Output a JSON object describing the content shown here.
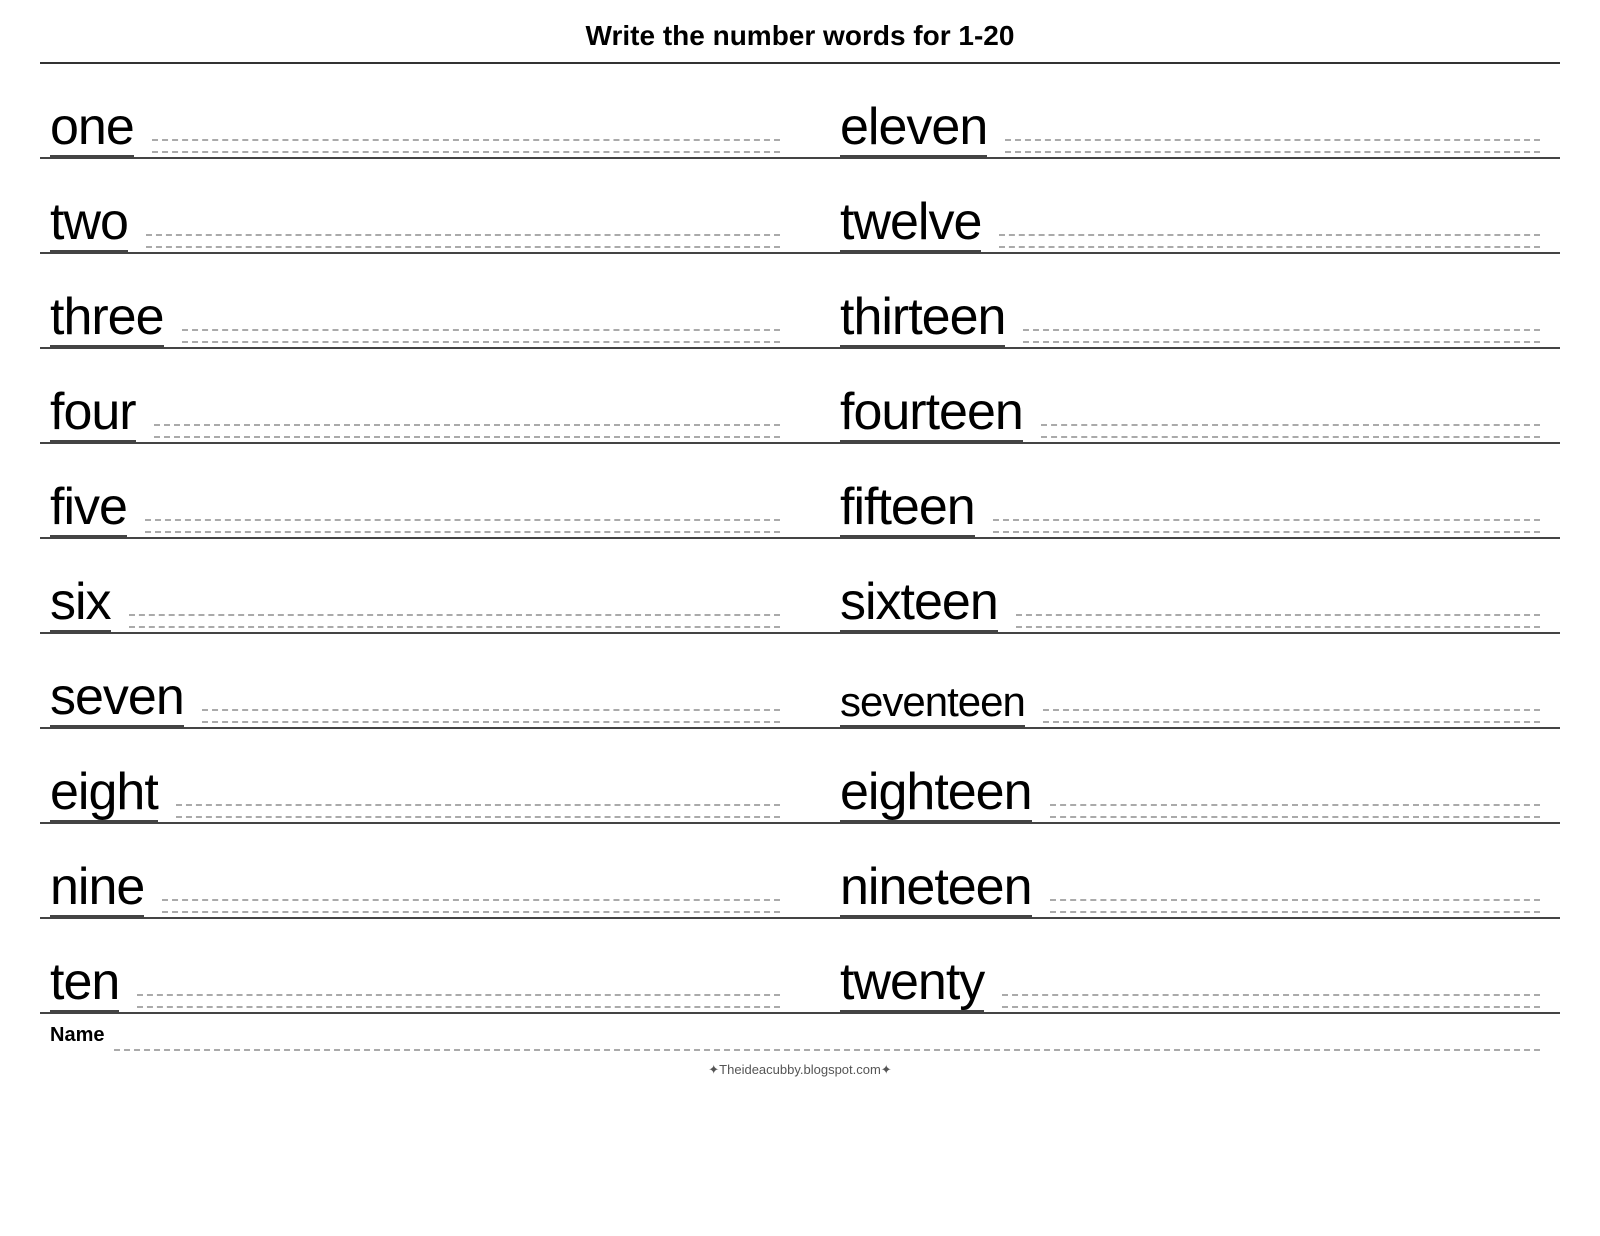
{
  "title": "Write the number words for  1-20",
  "left_column": [
    {
      "word": "one"
    },
    {
      "word": "two"
    },
    {
      "word": "three"
    },
    {
      "word": "four"
    },
    {
      "word": "five"
    },
    {
      "word": "six"
    },
    {
      "word": "seven"
    },
    {
      "word": "eight"
    },
    {
      "word": "nine"
    },
    {
      "word": "ten"
    }
  ],
  "right_column": [
    {
      "word": "eleven"
    },
    {
      "word": "twelve"
    },
    {
      "word": "thirteen"
    },
    {
      "word": "fourteen"
    },
    {
      "word": "fifteen"
    },
    {
      "word": "sixteen"
    },
    {
      "word": "seventeen"
    },
    {
      "word": "eighteen"
    },
    {
      "word": "nineteen"
    },
    {
      "word": "twenty"
    }
  ],
  "name_label": "Name",
  "footer": "✦Theideacubby.blogspot.com✦"
}
